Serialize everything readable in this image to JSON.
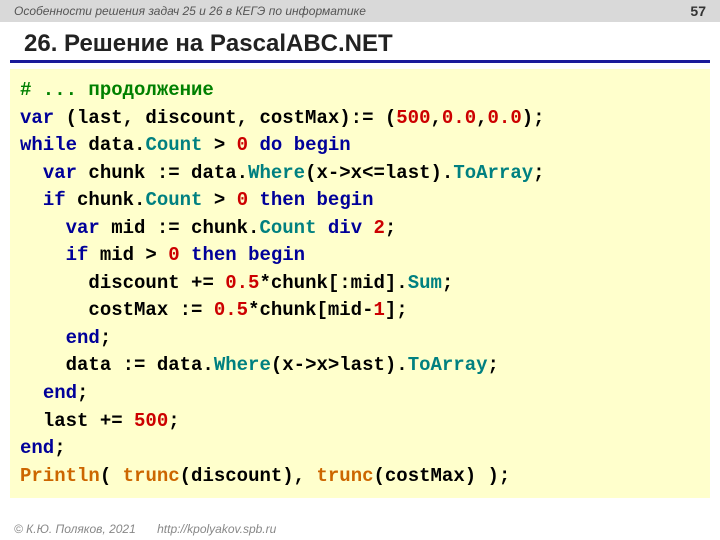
{
  "header": {
    "subject": "Особенности решения задач 25 и 26 в КЕГЭ по информатике",
    "page": "57"
  },
  "title": "26. Решение на PascalABC.NET",
  "code": {
    "l1_comment": "# ... продолжение",
    "l2_var": "var",
    "l2_mid": " (last, discount, costMax):= (",
    "l2_n1": "500",
    "l2_c1": ",",
    "l2_n2": "0.0",
    "l2_c2": ",",
    "l2_n3": "0.0",
    "l2_end": ");",
    "l3_while": "while",
    "l3_a": " data.",
    "l3_count": "Count",
    "l3_b": " > ",
    "l3_zero": "0",
    "l3_c": " ",
    "l3_do": "do",
    "l3_sp": " ",
    "l3_begin": "begin",
    "l4_pad": "  ",
    "l4_var": "var",
    "l4_a": " chunk := data.",
    "l4_where": "Where",
    "l4_b": "(x->x<=last).",
    "l4_toarr": "ToArray",
    "l4_end": ";",
    "l5_pad": "  ",
    "l5_if": "if",
    "l5_a": " chunk.",
    "l5_count": "Count",
    "l5_b": " > ",
    "l5_zero": "0",
    "l5_sp": " ",
    "l5_then": "then",
    "l5_sp2": " ",
    "l5_begin": "begin",
    "l6_pad": "    ",
    "l6_var": "var",
    "l6_a": " mid := chunk.",
    "l6_count": "Count",
    "l6_sp": " ",
    "l6_div": "div",
    "l6_sp2": " ",
    "l6_two": "2",
    "l6_end": ";",
    "l7_pad": "    ",
    "l7_if": "if",
    "l7_a": " mid > ",
    "l7_zero": "0",
    "l7_sp": " ",
    "l7_then": "then",
    "l7_sp2": " ",
    "l7_begin": "begin",
    "l8_pad": "      ",
    "l8_a": "discount += ",
    "l8_half": "0.5",
    "l8_b": "*chunk[:mid].",
    "l8_sum": "Sum",
    "l8_end": ";",
    "l9_pad": "      ",
    "l9_a": "costMax := ",
    "l9_half": "0.5",
    "l9_b": "*chunk[mid-",
    "l9_one": "1",
    "l9_end": "];",
    "l10_pad": "    ",
    "l10_end": "end",
    "l10_semi": ";",
    "l11_pad": "    ",
    "l11_a": "data := data.",
    "l11_where": "Where",
    "l11_b": "(x->x>last).",
    "l11_toarr": "ToArray",
    "l11_end": ";",
    "l12_pad": "  ",
    "l12_end": "end",
    "l12_semi": ";",
    "l13_pad": "  ",
    "l13_a": "last += ",
    "l13_n": "500",
    "l13_end": ";",
    "l14_end": "end",
    "l14_semi": ";",
    "l15_println": "Println",
    "l15_a": "( ",
    "l15_trunc1": "trunc",
    "l15_b": "(discount), ",
    "l15_trunc2": "trunc",
    "l15_c": "(costMax) );"
  },
  "footer": {
    "copyright": "© К.Ю. Поляков, 2021",
    "url": "http://kpolyakov.spb.ru"
  }
}
